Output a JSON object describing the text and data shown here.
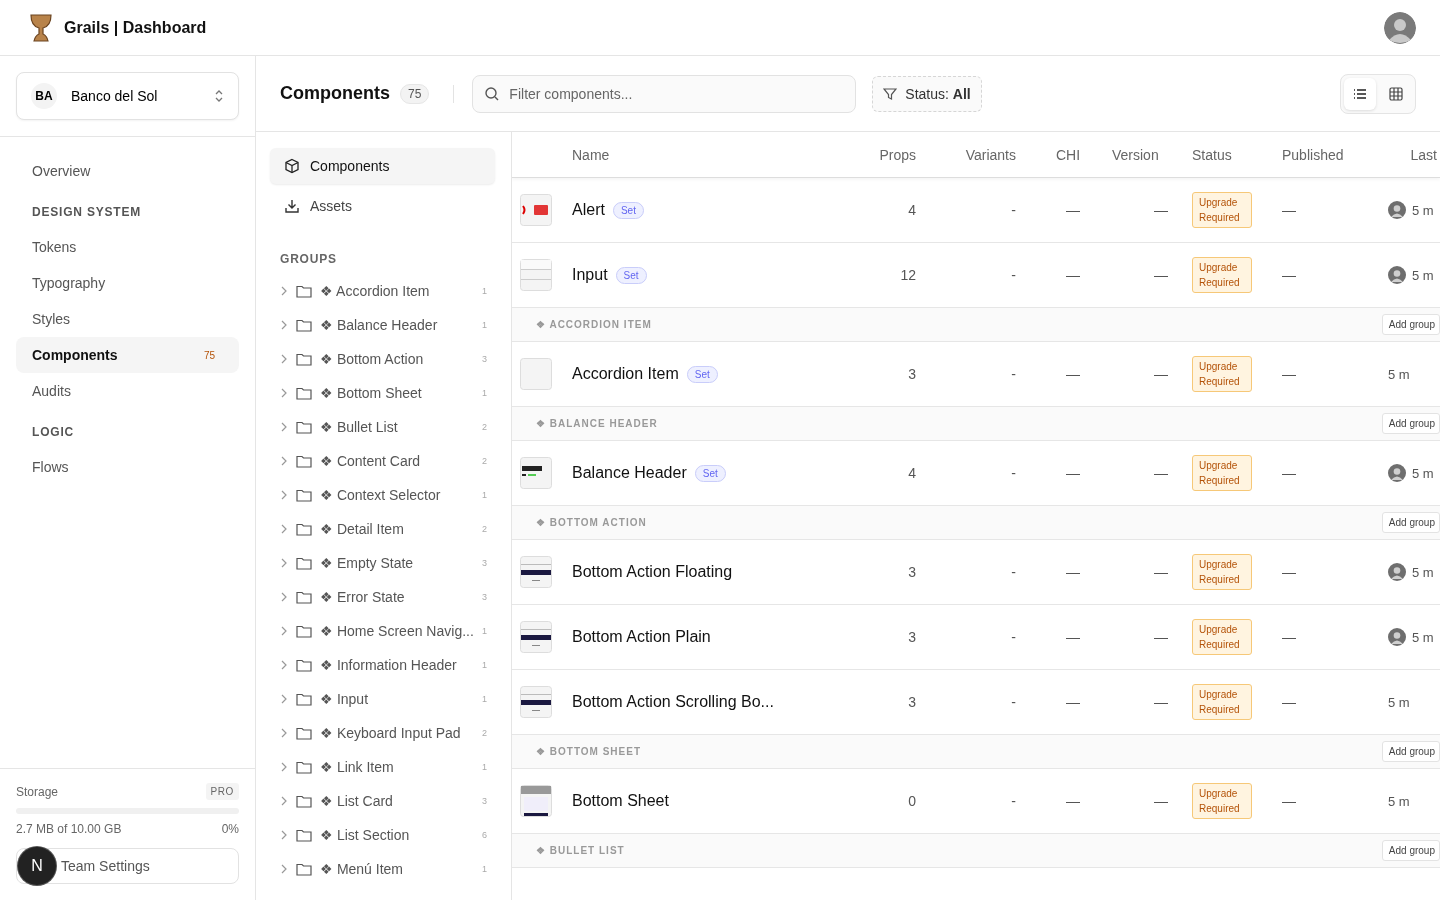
{
  "app": {
    "title": "Grails | Dashboard"
  },
  "workspace": {
    "initials": "BA",
    "name": "Banco del Sol"
  },
  "nav": [
    {
      "kind": "link",
      "label": "Overview",
      "selected": false
    },
    {
      "kind": "section",
      "label": "DESIGN SYSTEM"
    },
    {
      "kind": "link",
      "label": "Tokens",
      "selected": false
    },
    {
      "kind": "link",
      "label": "Typography",
      "selected": false
    },
    {
      "kind": "link",
      "label": "Styles",
      "selected": false
    },
    {
      "kind": "link",
      "label": "Components",
      "selected": true,
      "count": "75"
    },
    {
      "kind": "link",
      "label": "Audits",
      "selected": false
    },
    {
      "kind": "section",
      "label": "LOGIC"
    },
    {
      "kind": "link",
      "label": "Flows",
      "selected": false
    }
  ],
  "storage": {
    "label": "Storage",
    "plan": "PRO",
    "level": 0,
    "usage": "2.7 MB of 10.00 GB",
    "percent": "0%"
  },
  "team_settings": "Team Settings",
  "dev_badge": "N",
  "toolbar": {
    "title": "Components",
    "count": "75",
    "search_placeholder": "Filter components...",
    "filter": "Status: **All**",
    "views": [
      {
        "kind": "list",
        "selected": true
      },
      {
        "kind": "grid",
        "selected": false
      }
    ]
  },
  "library": [
    {
      "kind": "components",
      "label": "Components",
      "selected": true
    },
    {
      "kind": "assets",
      "label": "Assets",
      "selected": false
    }
  ],
  "groups_heading": "GROUPS",
  "groups": [
    {
      "name": "❖ Accordion Item",
      "count": "1"
    },
    {
      "name": "❖ Balance Header",
      "count": "1"
    },
    {
      "name": "❖ Bottom Action",
      "count": "3"
    },
    {
      "name": "❖ Bottom Sheet",
      "count": "1"
    },
    {
      "name": "❖ Bullet List",
      "count": "2"
    },
    {
      "name": "❖ Content Card",
      "count": "2"
    },
    {
      "name": "❖ Context Selector",
      "count": "1"
    },
    {
      "name": "❖ Detail Item",
      "count": "2"
    },
    {
      "name": "❖ Empty State",
      "count": "3"
    },
    {
      "name": "❖ Error State",
      "count": "3"
    },
    {
      "name": "❖ Home Screen Navig...",
      "count": "1"
    },
    {
      "name": "❖ Information Header",
      "count": "1"
    },
    {
      "name": "❖ Input",
      "count": "1"
    },
    {
      "name": "❖ Keyboard Input Pad",
      "count": "2"
    },
    {
      "name": "❖ Link Item",
      "count": "1"
    },
    {
      "name": "❖ List Card",
      "count": "3"
    },
    {
      "name": "❖ List Section",
      "count": "6"
    },
    {
      "name": "❖ Menú Item",
      "count": "1"
    }
  ],
  "table": {
    "columns": [
      "Name",
      "Props",
      "Variants",
      "CHI",
      "Version",
      "Status",
      "Published",
      "Last"
    ],
    "rows": [
      {
        "kind": "component",
        "thumb": {
          "kind": "alert"
        },
        "name": "Alert",
        "badge": "Set",
        "props": "4",
        "variants": "-",
        "chi": "—",
        "version": "—",
        "status": "Upgrade Required",
        "published": "—",
        "avatar": true,
        "last": "5 m"
      },
      {
        "kind": "component",
        "thumb": {
          "kind": "input"
        },
        "name": "Input",
        "badge": "Set",
        "props": "12",
        "variants": "-",
        "chi": "—",
        "version": "—",
        "status": "Upgrade Required",
        "published": "—",
        "avatar": true,
        "last": "5 m"
      },
      {
        "kind": "group",
        "label": "❖ ACCORDION ITEM",
        "action": "Add group"
      },
      {
        "kind": "component",
        "thumb": {
          "kind": "blank"
        },
        "name": "Accordion Item",
        "badge": "Set",
        "props": "3",
        "variants": "-",
        "chi": "—",
        "version": "—",
        "status": "Upgrade Required",
        "published": "—",
        "avatar": false,
        "last": "5 m"
      },
      {
        "kind": "group",
        "label": "❖ BALANCE HEADER",
        "action": "Add group"
      },
      {
        "kind": "component",
        "thumb": {
          "kind": "balance"
        },
        "name": "Balance Header",
        "badge": "Set",
        "props": "4",
        "variants": "-",
        "chi": "—",
        "version": "—",
        "status": "Upgrade Required",
        "published": "—",
        "avatar": true,
        "last": "5 m"
      },
      {
        "kind": "group",
        "label": "❖ BOTTOM ACTION",
        "action": "Add group"
      },
      {
        "kind": "component",
        "thumb": {
          "kind": "action"
        },
        "name": "Bottom Action Floating",
        "props": "3",
        "variants": "-",
        "chi": "—",
        "version": "—",
        "status": "Upgrade Required",
        "published": "—",
        "avatar": true,
        "last": "5 m"
      },
      {
        "kind": "component",
        "thumb": {
          "kind": "action"
        },
        "name": "Bottom Action Plain",
        "props": "3",
        "variants": "-",
        "chi": "—",
        "version": "—",
        "status": "Upgrade Required",
        "published": "—",
        "avatar": true,
        "last": "5 m"
      },
      {
        "kind": "component",
        "thumb": {
          "kind": "action"
        },
        "name": "Bottom Action Scrolling Bo...",
        "props": "3",
        "variants": "-",
        "chi": "—",
        "version": "—",
        "status": "Upgrade Required",
        "published": "—",
        "avatar": false,
        "last": "5 m"
      },
      {
        "kind": "group",
        "label": "❖ BOTTOM SHEET",
        "action": "Add group"
      },
      {
        "kind": "component",
        "thumb": {
          "kind": "sheet"
        },
        "name": "Bottom Sheet",
        "props": "0",
        "variants": "-",
        "chi": "—",
        "version": "—",
        "status": "Upgrade Required",
        "published": "—",
        "avatar": false,
        "last": "5 m"
      },
      {
        "kind": "group",
        "label": "❖ BULLET LIST",
        "action": "Add group"
      }
    ]
  }
}
